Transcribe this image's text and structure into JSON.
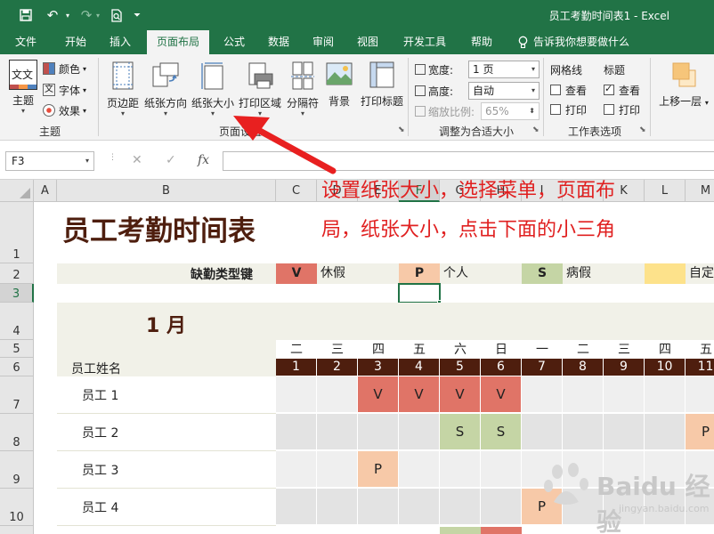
{
  "app": {
    "doc_title": "员工考勤时间表1  -  Excel"
  },
  "colors": {
    "brand": "#217346",
    "date_header": "#4e1e0e",
    "vacation": "#e07467",
    "personal": "#f7c9a8",
    "sick": "#c5d5a5",
    "custom": "#fde28b",
    "band": "#f1f1e8"
  },
  "qat": {
    "icons": [
      "save-icon",
      "undo-icon",
      "redo-icon",
      "print-preview-icon",
      "customize-icon"
    ]
  },
  "ribbon_tabs": [
    {
      "label": "文件",
      "active": false
    },
    {
      "label": "开始",
      "active": false
    },
    {
      "label": "插入",
      "active": false
    },
    {
      "label": "页面布局",
      "active": true
    },
    {
      "label": "公式",
      "active": false
    },
    {
      "label": "数据",
      "active": false
    },
    {
      "label": "审阅",
      "active": false
    },
    {
      "label": "视图",
      "active": false
    },
    {
      "label": "开发工具",
      "active": false
    },
    {
      "label": "帮助",
      "active": false
    }
  ],
  "tell_me": "告诉我你想要做什么",
  "ribbon": {
    "themes": {
      "theme_label": "主题",
      "theme_icon_text": "文文",
      "colors_label": "颜色",
      "fonts_label": "字体",
      "effects_label": "效果",
      "group_label": "主题"
    },
    "page_setup": {
      "margins": "页边距",
      "orientation": "纸张方向",
      "size": "纸张大小",
      "print_area": "打印区域",
      "breaks": "分隔符",
      "background": "背景",
      "print_titles": "打印标题",
      "group_label": "页面设置"
    },
    "scale": {
      "width_label": "宽度:",
      "width_value": "1 页",
      "height_label": "高度:",
      "height_value": "自动",
      "scale_label": "缩放比例:",
      "scale_value": "65%",
      "group_label": "调整为合适大小"
    },
    "sheet_options": {
      "gridlines": "网格线",
      "headings": "标题",
      "view": "查看",
      "print": "打印",
      "gridlines_view": false,
      "gridlines_print": false,
      "headings_view": true,
      "headings_print": false,
      "group_label": "工作表选项"
    },
    "arrange": {
      "bring_forward": "上移一层"
    }
  },
  "formula_bar": {
    "name_box": "F3",
    "cancel": "✕",
    "enter": "✓",
    "fx": "fx",
    "formula": ""
  },
  "sheet": {
    "columns": [
      "A",
      "B",
      "C",
      "D",
      "E",
      "F",
      "G",
      "H",
      "I",
      "J",
      "K",
      "L",
      "M"
    ],
    "selected_column": "F",
    "rows": [
      "1",
      "2",
      "3",
      "4",
      "5",
      "6",
      "7",
      "8",
      "9",
      "10"
    ],
    "selected_row": "3",
    "title": "员工考勤时间表",
    "legend_title": "缺勤类型键",
    "legend": [
      {
        "code": "V",
        "label": "休假"
      },
      {
        "code": "P",
        "label": "个人"
      },
      {
        "code": "S",
        "label": "病假"
      },
      {
        "code": "",
        "label": "自定"
      }
    ],
    "month": "1 月",
    "employee_header": "员工姓名",
    "weekdays": [
      "二",
      "三",
      "四",
      "五",
      "六",
      "日",
      "一",
      "二",
      "三",
      "四",
      "五"
    ],
    "dates": [
      "1",
      "2",
      "3",
      "4",
      "5",
      "6",
      "7",
      "8",
      "9",
      "10",
      "11"
    ],
    "employees": [
      {
        "name": "员工 1",
        "marks": [
          "",
          "",
          "V",
          "V",
          "V",
          "V",
          "",
          "",
          "",
          "",
          ""
        ]
      },
      {
        "name": "员工 2",
        "marks": [
          "",
          "",
          "",
          "",
          "S",
          "S",
          "",
          "",
          "",
          "",
          "P"
        ]
      },
      {
        "name": "员工 3",
        "marks": [
          "",
          "",
          "P",
          "",
          "",
          "",
          "",
          "",
          "",
          "",
          ""
        ]
      },
      {
        "name": "员工 4",
        "marks": [
          "",
          "",
          "",
          "",
          "",
          "",
          "P",
          "",
          "",
          "",
          ""
        ]
      }
    ]
  },
  "annotation": {
    "line1": "设置纸张大小，选择菜单，页面布",
    "line2": "局，纸张大小，点击下面的小三角"
  },
  "watermark": {
    "brand": "Baidu 经验",
    "url": "jingyan.baidu.com"
  }
}
